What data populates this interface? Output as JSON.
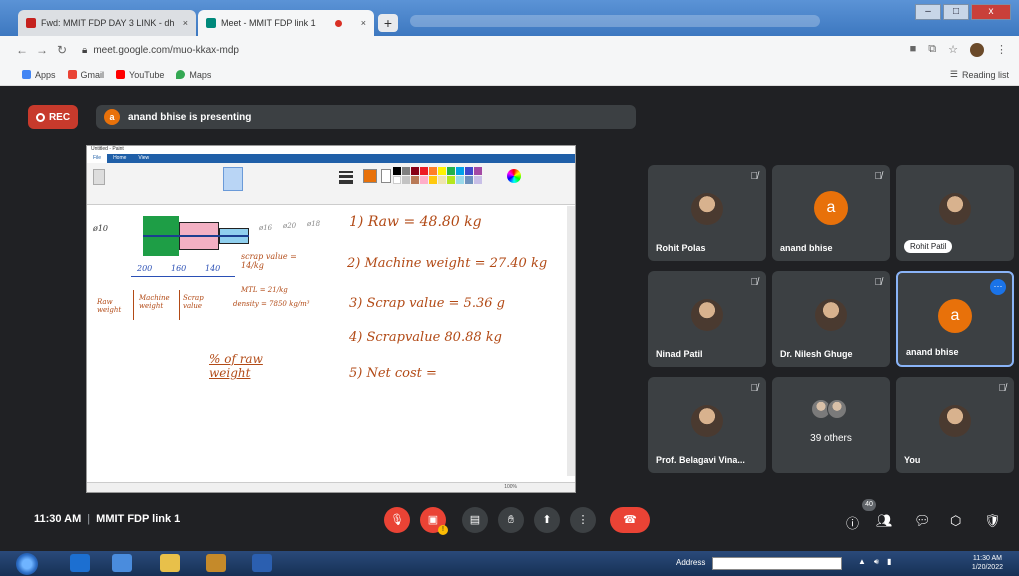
{
  "browser": {
    "tabs": [
      {
        "label": "Fwd: MMIT FDP DAY 3 LINK - dh",
        "close": "×",
        "favicon_color": "#c5221f"
      },
      {
        "label": "Meet - MMIT FDP link 1",
        "close": "×",
        "favicon_color": "#00897b"
      }
    ],
    "new_tab": "+",
    "window_buttons": {
      "minimize": "–",
      "maximize": "□",
      "close": "x"
    },
    "url": "meet.google.com/muo-kkax-mdp",
    "bookmarks": [
      {
        "label": "Apps",
        "color": "#4285f4"
      },
      {
        "label": "Gmail",
        "color": "#ea4335"
      },
      {
        "label": "YouTube",
        "color": "#ff0000"
      },
      {
        "label": "Maps",
        "color": "#34a853"
      }
    ],
    "reading_list": "Reading list"
  },
  "meet": {
    "rec_label": "REC",
    "presenter_initial": "a",
    "presenting_text": "anand bhise is presenting",
    "shared_screen": {
      "title": "Untitled - Paint",
      "menu": [
        "File",
        "Home",
        "View"
      ],
      "status_text": "100%",
      "handwriting": [
        "1) Raw = 48.80 kg",
        "2) Machine weight = 27.40 kg",
        "3) Scrap value = 5.36 g",
        "4) Scrapvalue 80.88 kg",
        "5) Net cost =",
        "% of raw weight"
      ],
      "diagram_labels": {
        "dim_left": "ø10",
        "dim_a": "ø16",
        "dim_b": "ø20",
        "dim_c": "ø18",
        "lengths": [
          "200",
          "160",
          "140"
        ],
        "scrap_note": "scrap value = 14/kg",
        "mtl_note": "MTL = 21/kg",
        "density_note": "density = 7850 kg/m³",
        "table_heads": [
          "Raw weight",
          "Machine weight",
          "Scrap value"
        ]
      }
    },
    "participants": [
      {
        "name": "Rohit Polas",
        "type": "photo",
        "muted": true
      },
      {
        "name": "anand bhise",
        "type": "letter",
        "initial": "a",
        "muted": true
      },
      {
        "name": "Rohit Patil",
        "type": "photo",
        "muted": false,
        "pill": true
      },
      {
        "name": "Ninad Patil",
        "type": "photo",
        "muted": true
      },
      {
        "name": "Dr. Nilesh Ghuge",
        "type": "photo",
        "muted": true
      },
      {
        "name": "anand bhise",
        "type": "letter",
        "initial": "a",
        "muted": false,
        "highlight": true
      },
      {
        "name": "Prof. Belagavi Vina...",
        "type": "photo",
        "muted": true
      },
      {
        "name": "39 others",
        "type": "group",
        "muted": false
      },
      {
        "name": "You",
        "type": "photo",
        "muted": true
      }
    ],
    "bottom": {
      "time": "11:30 AM",
      "meeting_name": "MMIT FDP link 1",
      "participant_count": "40"
    }
  },
  "taskbar": {
    "address_label": "Address",
    "clock_time": "11:30 AM",
    "clock_date": "1/20/2022"
  }
}
